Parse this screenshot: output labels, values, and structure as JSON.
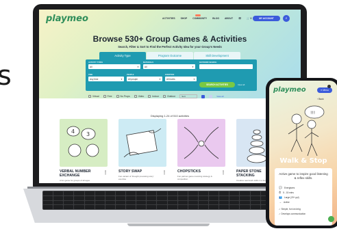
{
  "laptop": {
    "logo": "playmeo",
    "nav": [
      "ACTIVITIES",
      "SHOP",
      "COMMUNITY",
      "BLOG",
      "ABOUT",
      "☏",
      "🛒 0",
      "LOGOUT"
    ],
    "account_button": "MY ACCOUNT",
    "hero_title": "Browse 530+ Group Games & Activities",
    "hero_subtitle": "Search, Filter & Sort to Find the Perfect Activity Idea for your Group's Needs",
    "tabs": [
      {
        "label": "Activity Type",
        "active": true
      },
      {
        "label": "Program Outcome",
        "active": false
      },
      {
        "label": "Skill Development",
        "active": false
      }
    ],
    "filters_panel": {
      "activity_types_label": "ACTIVITY TYPES",
      "activity_types_value": "All",
      "materials_label": "MATERIALS",
      "materials_value": "All",
      "keyword_label": "KEYWORD SEARCH",
      "time_label": "TIME",
      "time_value": "Any time",
      "people_label": "PEOPLE",
      "people_value": "All people",
      "exertion_label": "EXERTION",
      "exertion_value": "All levels",
      "search_button": "SEARCH ACTIVITIES",
      "clear_link": "Clear all"
    },
    "checkboxes": [
      "Virtual",
      "Free",
      "No Props",
      "Video",
      "Indoor",
      "Outdoor"
    ],
    "sort_value": "Sort",
    "view_all": "View all",
    "results_count": "Displaying 1-24 of 510 activities",
    "cards": [
      {
        "title": "VERBAL NUMBER EXCHANGE",
        "sub": "A fun game for groups of all ages",
        "bg": "#d6edc3"
      },
      {
        "title": "STORY SWAP",
        "sub": "Fun variant of 'thought provoking story' exercise",
        "bg": "#cdebf4"
      },
      {
        "title": "CHOPSTICKS",
        "sub": "Fun partner game involving strategy & competition",
        "bg": "#eac9ef"
      },
      {
        "title": "PAPER STONE STACKING",
        "sub": "Creative teamwork skills in a fun challenge",
        "bg": "#d8e6f3"
      }
    ]
  },
  "phone": {
    "logo": "playmeo",
    "menu_button": "≡ Menu",
    "back_link": "‹ Back",
    "activity_title": "Walk & Stop",
    "activity_desc": "Active game to inspire good listening & reflex skills.",
    "meta": [
      {
        "icon": "💬",
        "text": "Energisers"
      },
      {
        "icon": "⏱",
        "text": "5 - 15 mins"
      },
      {
        "icon": "👥",
        "text": "Large (20+ ppl)"
      },
      {
        "icon": "→",
        "text": "Active"
      }
    ],
    "tags": [
      "✓ Simple, fun ice-brkg",
      "✓ Develops communication"
    ],
    "speech_bubble": "!!!"
  },
  "colors": {
    "brand_green": "#2f8e5a",
    "teal": "#1f9bb1",
    "blue": "#3b5bdb",
    "cta_green": "#7ac943"
  }
}
